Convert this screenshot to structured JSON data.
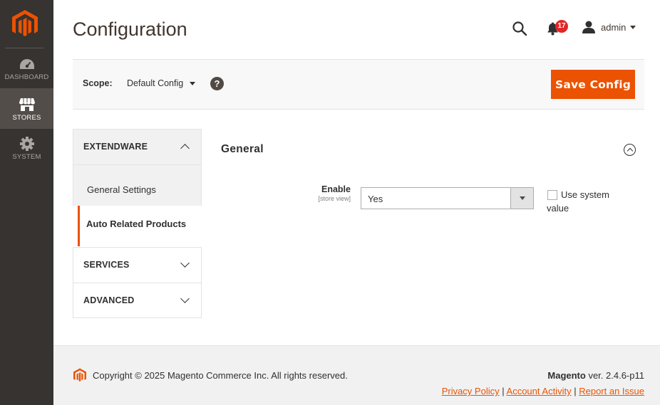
{
  "page": {
    "title": "Configuration"
  },
  "sidebar": {
    "items": [
      {
        "label": "DASHBOARD",
        "icon": "dashboard-icon",
        "active": false
      },
      {
        "label": "STORES",
        "icon": "store-icon",
        "active": true
      },
      {
        "label": "SYSTEM",
        "icon": "gear-icon",
        "active": false
      }
    ]
  },
  "header": {
    "notifications_count": "17",
    "user_name": "admin"
  },
  "scope": {
    "label": "Scope:",
    "value": "Default Config",
    "help": "?"
  },
  "actions": {
    "save_label": "Save Config"
  },
  "config_nav": {
    "sections": [
      {
        "title": "EXTENDWARE",
        "open": true,
        "items": [
          {
            "label": "General Settings",
            "active": false
          },
          {
            "label": "Auto Related Products",
            "active": true
          }
        ]
      },
      {
        "title": "SERVICES",
        "open": false
      },
      {
        "title": "ADVANCED",
        "open": false
      }
    ]
  },
  "main": {
    "section_title": "General",
    "field": {
      "label": "Enable",
      "scope": "[store view]",
      "value": "Yes",
      "use_system_label": "Use system value",
      "use_system_checked": false
    }
  },
  "footer": {
    "copyright": "Copyright © 2025 Magento Commerce Inc. All rights reserved.",
    "brand": "Magento",
    "version": " ver. 2.4.6-p11",
    "links": [
      "Privacy Policy",
      " Account Activity",
      "Report an Issue"
    ],
    "separator": "|"
  },
  "colors": {
    "accent": "#eb5202",
    "sidebar_bg": "#373330",
    "badge": "#e22626"
  }
}
